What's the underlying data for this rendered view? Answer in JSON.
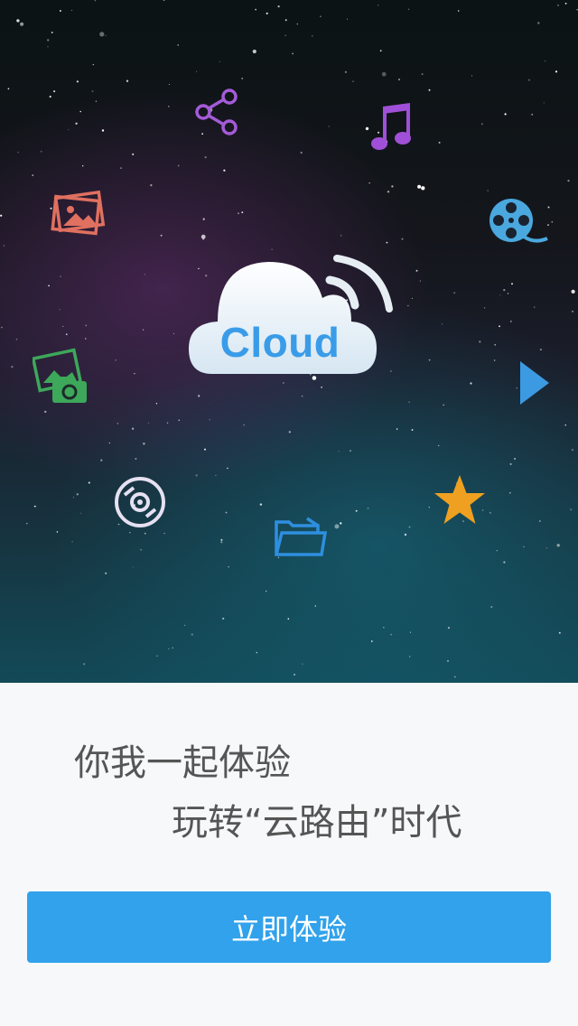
{
  "hero": {
    "cloud_label": "Cloud",
    "icons": [
      "share-icon",
      "music-note-icon",
      "photos-icon",
      "film-reel-icon",
      "gallery-camera-icon",
      "play-icon",
      "disc-icon",
      "star-icon",
      "folder-icon"
    ]
  },
  "tagline": {
    "line1": "你我一起体验",
    "line2": "玩转“云路由”时代"
  },
  "cta": {
    "label": "立即体验"
  },
  "colors": {
    "accent": "#31a2eb",
    "cloud_text": "#3a9ce8",
    "star": "#f0a020",
    "music": "#a050d8",
    "photos": "#e0705f",
    "gallery": "#3da85a",
    "film": "#4aa8de"
  }
}
